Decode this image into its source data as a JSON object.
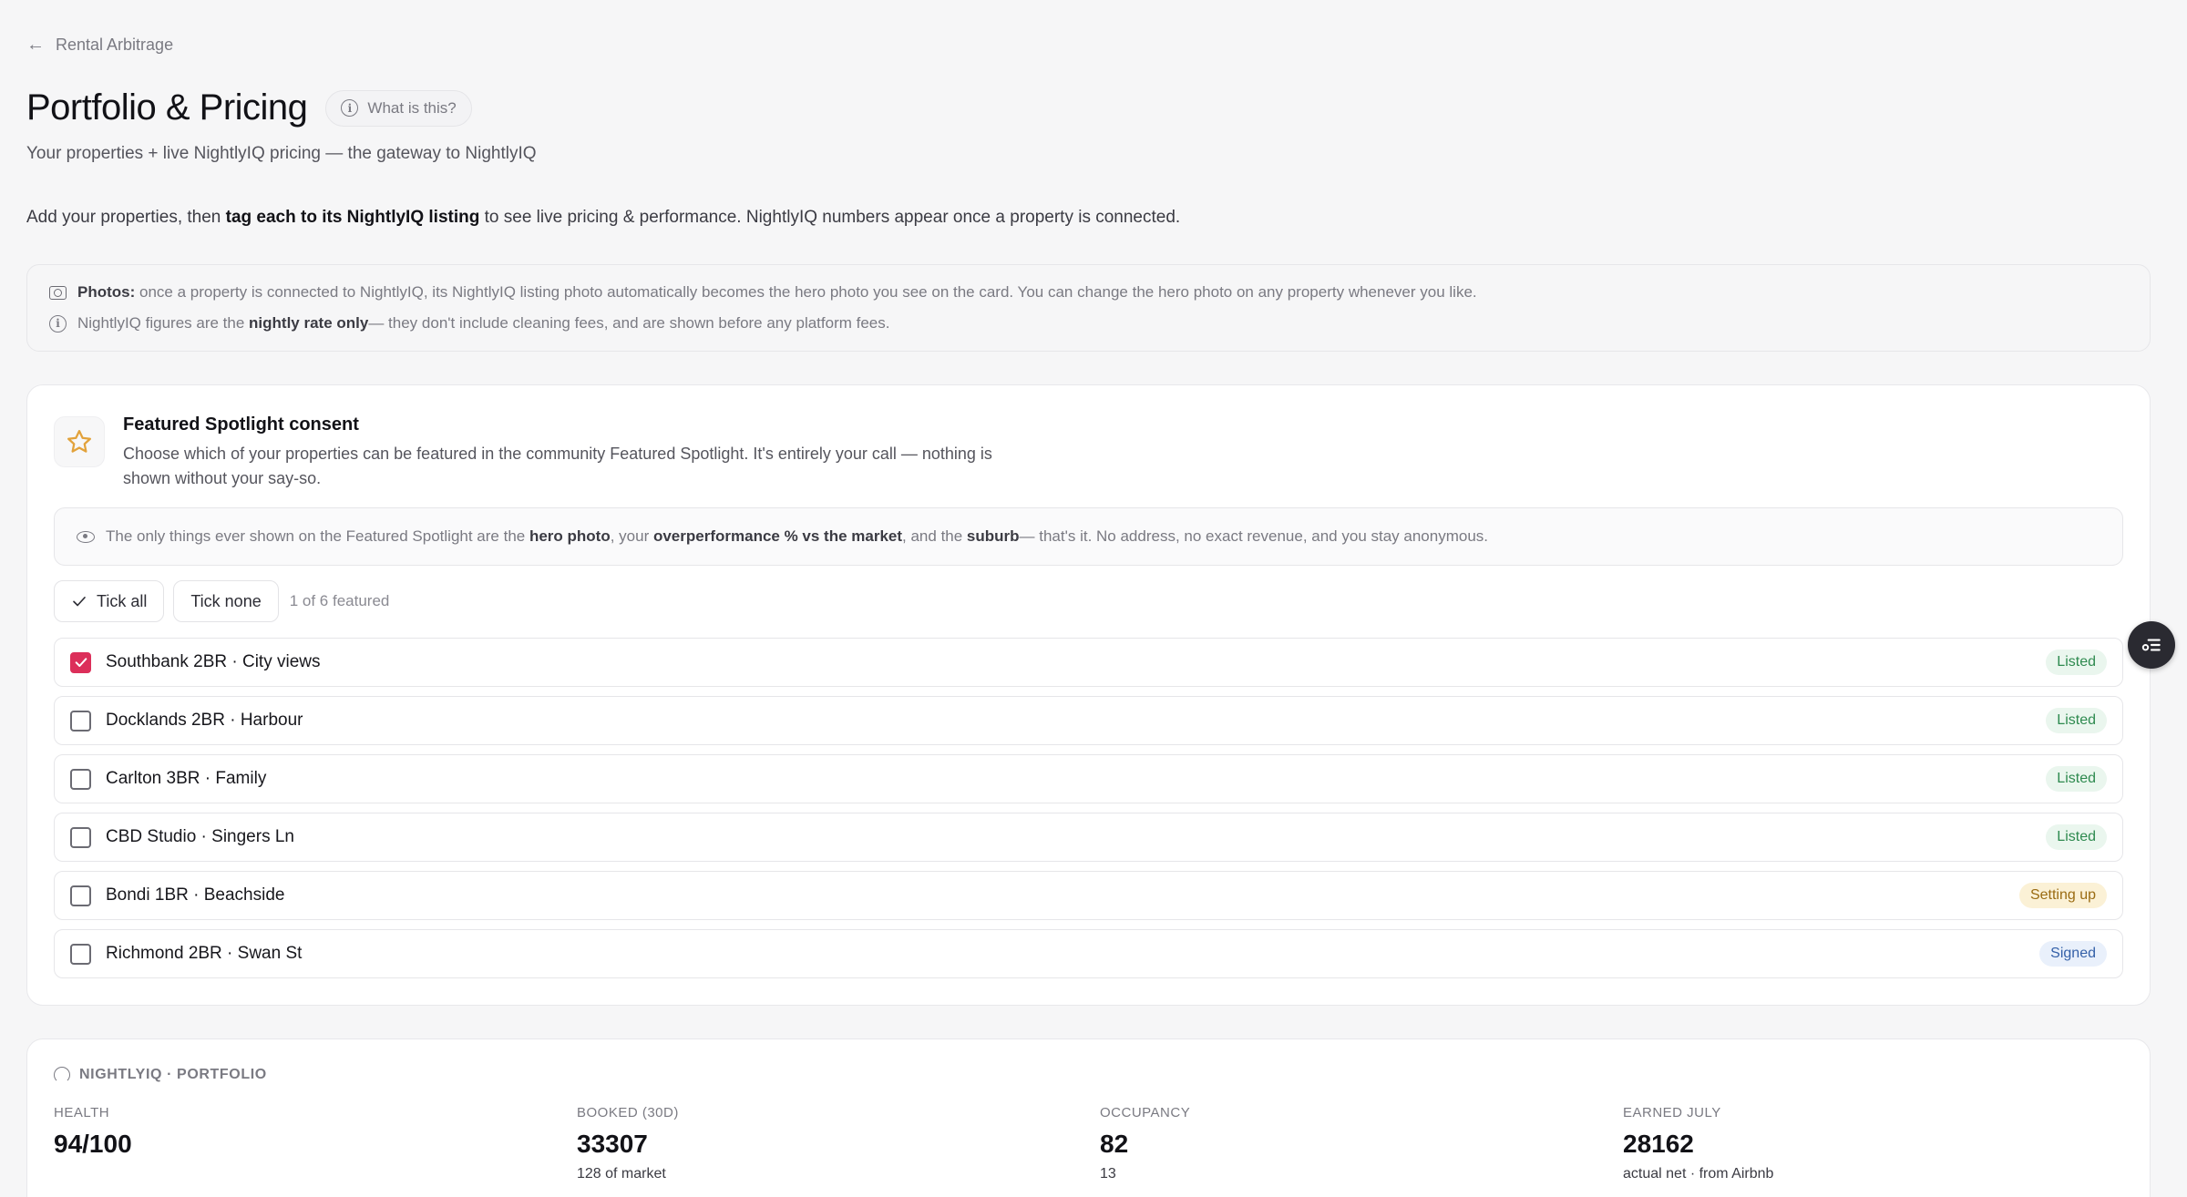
{
  "breadcrumb": {
    "label": "Rental Arbitrage"
  },
  "header": {
    "title": "Portfolio & Pricing",
    "what_label": "What is this?",
    "subtitle": "Your properties + live NightlyIQ pricing — the gateway to NightlyIQ"
  },
  "intro": {
    "before": "Add your properties, then ",
    "bold": "tag each to its NightlyIQ listing",
    "after": " to see live pricing & performance. NightlyIQ numbers appear once a property is connected."
  },
  "notes": {
    "photos_bold": "Photos:",
    "photos_text": " once a property is connected to NightlyIQ, its NightlyIQ listing photo automatically becomes the hero photo you see on the card. You can change the hero photo on any property whenever you like.",
    "rate_before": "NightlyIQ figures are the ",
    "rate_bold": "nightly rate only",
    "rate_after": "— they don't include cleaning fees, and are shown before any platform fees."
  },
  "spotlight": {
    "title": "Featured Spotlight consent",
    "description": "Choose which of your properties can be featured in the community Featured Spotlight. It's entirely your call — nothing is shown without your say-so.",
    "privacy": {
      "t1": "The only things ever shown on the Featured Spotlight are the ",
      "b1": "hero photo",
      "t2": ", your ",
      "b2": "overperformance % vs the market",
      "t3": ", and the ",
      "b3": "suburb",
      "t4": "— that's it. No address, no exact revenue, and you stay anonymous."
    },
    "tick_all": "Tick all",
    "tick_none": "Tick none",
    "count": "1 of 6 featured",
    "properties": [
      {
        "name": "Southbank 2BR · City views",
        "status": "Listed"
      },
      {
        "name": "Docklands 2BR · Harbour",
        "status": "Listed"
      },
      {
        "name": "Carlton 3BR · Family",
        "status": "Listed"
      },
      {
        "name": "CBD Studio · Singers Ln",
        "status": "Listed"
      },
      {
        "name": "Bondi 1BR · Beachside",
        "status": "Setting up"
      },
      {
        "name": "Richmond 2BR · Swan St",
        "status": "Signed"
      }
    ]
  },
  "portfolio": {
    "heading": "NIGHTLYIQ · PORTFOLIO",
    "metrics": [
      {
        "label": "HEALTH",
        "value": "94/100",
        "sub": ""
      },
      {
        "label": "BOOKED (30D)",
        "value": "33307",
        "sub": "128 of market"
      },
      {
        "label": "OCCUPANCY",
        "value": "82",
        "sub": "13"
      },
      {
        "label": "EARNED JULY",
        "value": "28162",
        "sub": "actual net · from Airbnb"
      }
    ]
  },
  "colors": {
    "accent": "#dc2f5a",
    "star": "#e2a23b",
    "listed_bg": "#eaf6ee",
    "listed_text": "#2e8a4f",
    "setting_bg": "#fbf1d6",
    "signed_bg": "#e9f0fb"
  }
}
